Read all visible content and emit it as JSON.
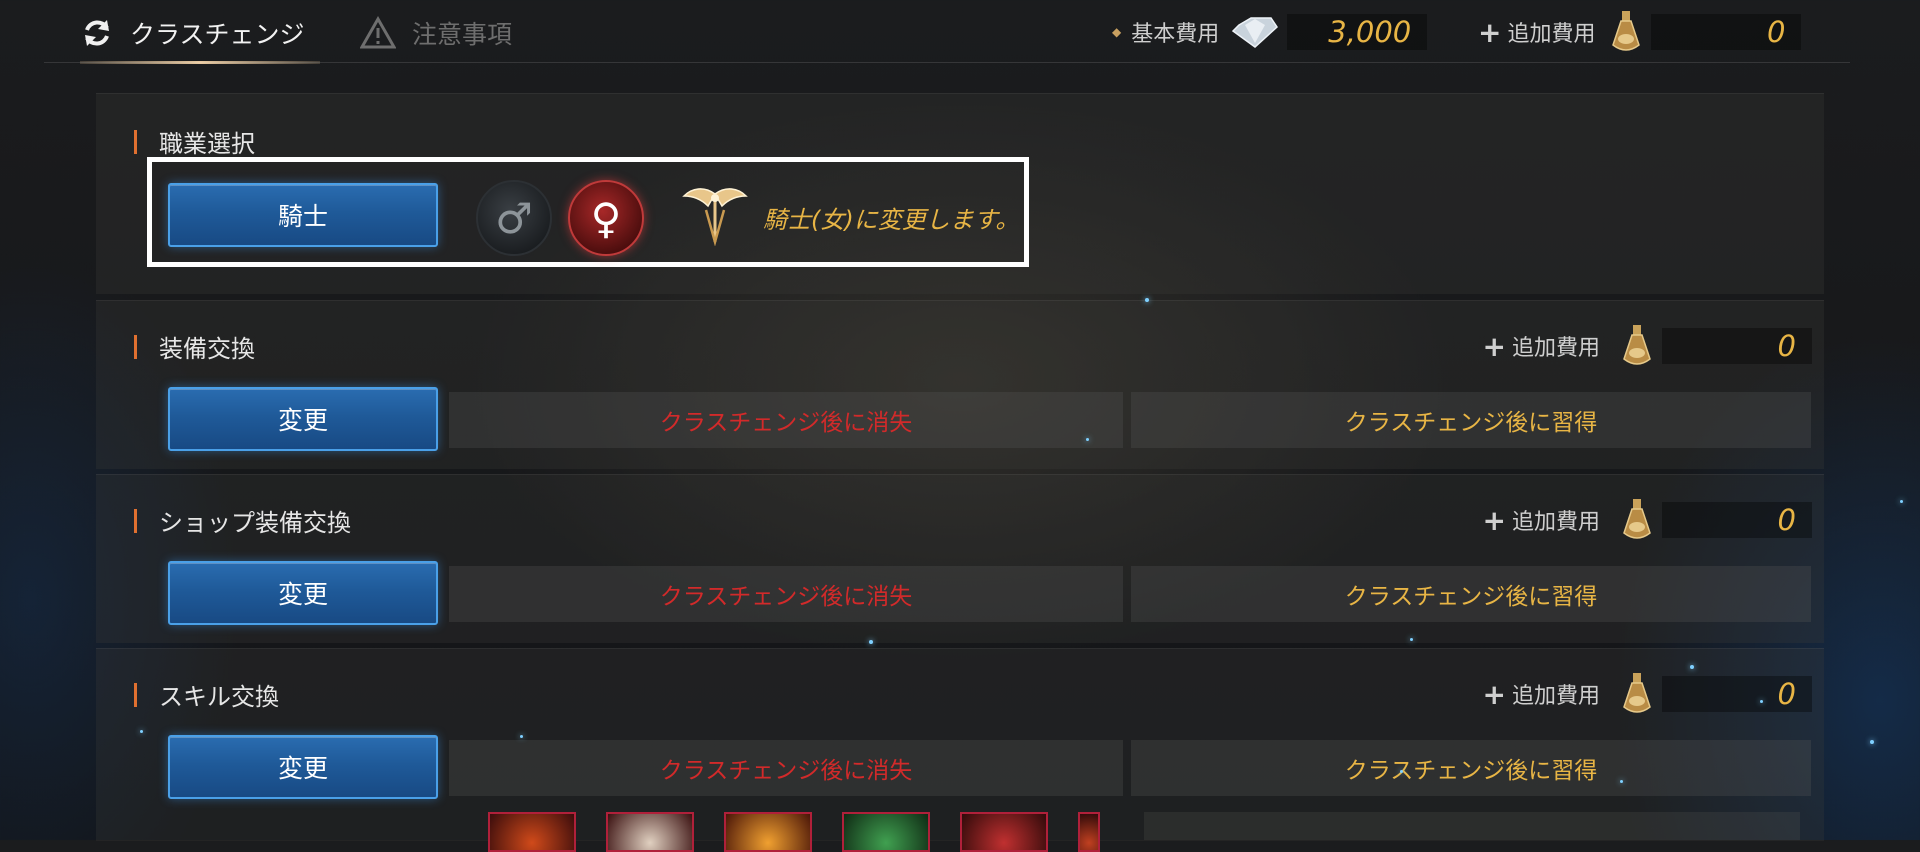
{
  "tabs": [
    {
      "label": "クラスチェンジ",
      "icon": "refresh-icon",
      "active": true
    },
    {
      "label": "注意事項",
      "icon": "warning-icon",
      "active": false
    }
  ],
  "header": {
    "base_cost_label": "基本費用",
    "base_cost_value": "3,000",
    "base_cost_icon": "diamond-icon",
    "extra_cost_label": "追加費用",
    "extra_cost_value": "0",
    "extra_cost_icon": "potion-icon"
  },
  "class_select": {
    "title": "職業選択",
    "class_button": "騎士",
    "male_symbol": "♂",
    "female_symbol": "♀",
    "selected_gender": "female",
    "message": "騎士(女)に変更します。"
  },
  "sections": [
    {
      "title": "装備交換",
      "button": "変更",
      "extra_cost_label": "追加費用",
      "extra_cost_value": "0",
      "lost_label": "クラスチェンジ後に消失",
      "gain_label": "クラスチェンジ後に習得"
    },
    {
      "title": "ショップ装備交換",
      "button": "変更",
      "extra_cost_label": "追加費用",
      "extra_cost_value": "0",
      "lost_label": "クラスチェンジ後に消失",
      "gain_label": "クラスチェンジ後に習得"
    },
    {
      "title": "スキル交換",
      "button": "変更",
      "extra_cost_label": "追加費用",
      "extra_cost_value": "0",
      "lost_label": "クラスチェンジ後に消失",
      "gain_label": "クラスチェンジ後に習得"
    }
  ],
  "colors": {
    "accent_gold": "#e8b545",
    "lost_red": "#d22a2a",
    "button_blue": "#1f5a99",
    "section_bar": "#e07030"
  }
}
